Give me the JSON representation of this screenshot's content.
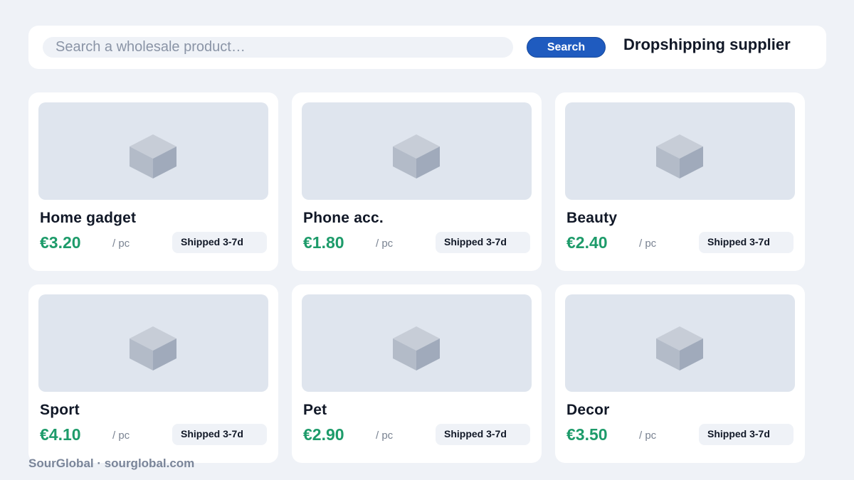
{
  "search": {
    "placeholder": "Search a wholesale product…",
    "value": "",
    "button_label": "Search"
  },
  "header": {
    "title": "Dropshipping supplier"
  },
  "products": [
    {
      "name": "Home gadget",
      "price": "€3.20",
      "unit": "/ pc",
      "shipping": "Shipped 3-7d",
      "icon": "box-icon"
    },
    {
      "name": "Phone acc.",
      "price": "€1.80",
      "unit": "/ pc",
      "shipping": "Shipped 3-7d",
      "icon": "box-icon"
    },
    {
      "name": "Beauty",
      "price": "€2.40",
      "unit": "/ pc",
      "shipping": "Shipped 3-7d",
      "icon": "box-icon"
    },
    {
      "name": "Sport",
      "price": "€4.10",
      "unit": "/ pc",
      "shipping": "Shipped 3-7d",
      "icon": "box-icon"
    },
    {
      "name": "Pet",
      "price": "€2.90",
      "unit": "/ pc",
      "shipping": "Shipped 3-7d",
      "icon": "box-icon"
    },
    {
      "name": "Decor",
      "price": "€3.50",
      "unit": "/ pc",
      "shipping": "Shipped 3-7d",
      "icon": "box-icon"
    }
  ],
  "footer": {
    "text": "SourGlobal · sourglobal.com"
  },
  "colors": {
    "background": "#eff2f7",
    "accent": "#1f5bbf",
    "price": "#1d9b6a",
    "thumbnail": "#dfe5ee"
  }
}
